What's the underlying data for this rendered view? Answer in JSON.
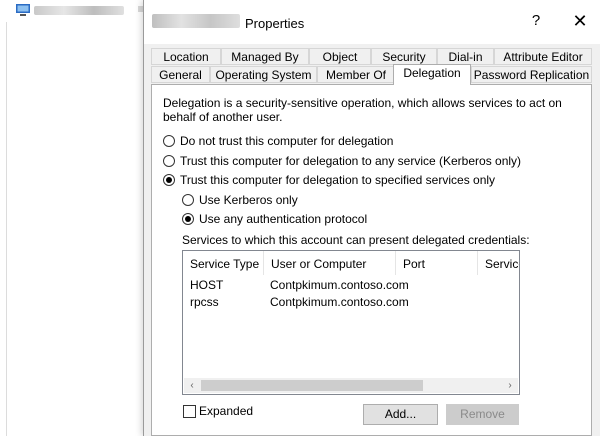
{
  "dialog": {
    "title": "Properties",
    "help_glyph": "?",
    "close_glyph": "✕"
  },
  "tabs_row1": [
    "Location",
    "Managed By",
    "Object",
    "Security",
    "Dial-in",
    "Attribute Editor"
  ],
  "tabs_row2": [
    "General",
    "Operating System",
    "Member Of",
    "Delegation",
    "Password Replication"
  ],
  "active_tab": "Delegation",
  "description": {
    "line1": "Delegation is a security-sensitive operation, which allows services to act on",
    "line2": "behalf of another user."
  },
  "options": {
    "no_trust": "Do not trust this computer for delegation",
    "trust_any": "Trust this computer for delegation to any service (Kerberos only)",
    "trust_specified": "Trust this computer for delegation to specified services only",
    "kerberos_only": "Use Kerberos only",
    "any_protocol": "Use any authentication protocol",
    "selected_main": "trust_specified",
    "selected_sub": "any_protocol"
  },
  "services_label": "Services to which this account can present delegated credentials:",
  "table": {
    "columns": [
      "Service Type",
      "User or Computer",
      "Port",
      "Service"
    ],
    "rows": [
      [
        "HOST",
        "Contpkimum.contoso.com",
        "",
        ""
      ],
      [
        "rpcss",
        "Contpkimum.contoso.com",
        "",
        ""
      ]
    ],
    "scroll_left": "‹",
    "scroll_right": "›"
  },
  "expanded": {
    "label": "Expanded",
    "checked": false
  },
  "buttons": {
    "add": "Add...",
    "remove": "Remove"
  }
}
